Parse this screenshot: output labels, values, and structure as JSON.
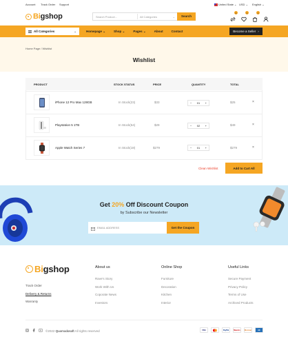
{
  "topbar": {
    "links": [
      "Account",
      "Track Order",
      "Support"
    ],
    "country": "United State",
    "currency": "USD",
    "language": "English"
  },
  "header": {
    "logo_prefix": "Bi",
    "logo_suffix": "gshop",
    "search_placeholder": "Search Product...",
    "category_select": "All Categories",
    "search_button": "Search",
    "compare_count": "2",
    "wishlist_count": "1",
    "cart_count": "1"
  },
  "nav": {
    "all_categories": "All Categories",
    "links": [
      "Homepage",
      "Shop",
      "Pages",
      "About",
      "Contact"
    ],
    "seller_button": "Become a Seller"
  },
  "page": {
    "breadcrumb": "Home Page / Wishlist",
    "title": "Wishlist"
  },
  "table": {
    "headers": [
      "PRODUCT",
      "STOCK STATUS",
      "PRICE",
      "QUANTITY",
      "TOTAL"
    ],
    "rows": [
      {
        "name": "iPhone 12 Pro Max 128GB",
        "stock": "In Stock(23)",
        "price": "$33",
        "qty": "01",
        "total": "$25",
        "remove": "×"
      },
      {
        "name": "Playstation 5 1TB",
        "stock": "In Stock(54)",
        "price": "$29",
        "qty": "02",
        "total": "$49",
        "remove": "×"
      },
      {
        "name": "Apple Watch Series 7",
        "stock": "In Stock(18)",
        "price": "$279",
        "qty": "01",
        "total": "$279",
        "remove": "×"
      }
    ]
  },
  "actions": {
    "clear": "Clean Wishlist",
    "add_all": "Add to Cart All"
  },
  "newsletter": {
    "title_pre": "Get ",
    "title_accent": "20%",
    "title_post": " Off Discount Coupon",
    "subtitle": "by Subscribe our Newsletter",
    "placeholder": "EMAIL ADDRESS",
    "button": "Get the Coupon"
  },
  "footer": {
    "links": [
      "Track Order",
      "Delivery & Returns",
      "Warranty"
    ],
    "columns": [
      {
        "title": "About us",
        "items": [
          "Rave's Story",
          "Work With Us",
          "Coporate News",
          "Investors"
        ]
      },
      {
        "title": "Online Shop",
        "items": [
          "Furniture",
          "Decoration",
          "Kitchen",
          "Interior"
        ]
      },
      {
        "title": "Useful Links",
        "items": [
          "Secure Payment",
          "Privacy Policy",
          "Terms of Use",
          "Archived Products"
        ]
      }
    ],
    "copyright_pre": "©2022",
    "copyright_brand": "Quomodosoft",
    "copyright_post": "All rights reserved",
    "payments": [
      "VISA",
      "MC",
      "PayPal",
      "Maestro",
      "Discover",
      "AE"
    ]
  },
  "colors": {
    "accent": "#f5a623",
    "page_header_bg": "#fff8ea",
    "newsletter_bg": "#cdeaf8",
    "danger": "#ec3f2a"
  }
}
